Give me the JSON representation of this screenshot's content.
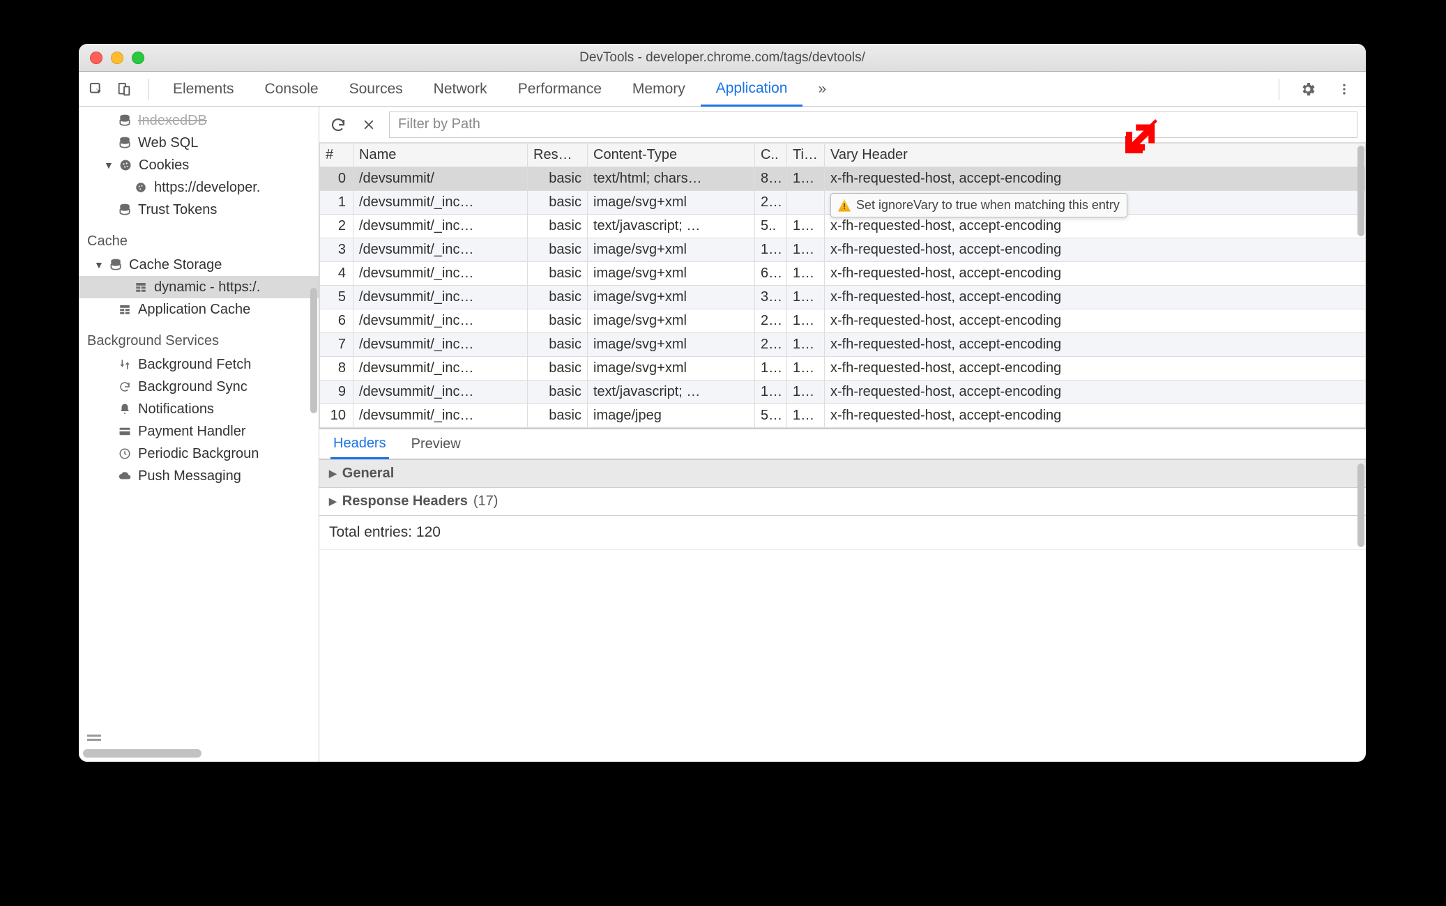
{
  "window": {
    "title": "DevTools - developer.chrome.com/tags/devtools/"
  },
  "tabs": {
    "items": [
      "Elements",
      "Console",
      "Sources",
      "Network",
      "Performance",
      "Memory",
      "Application"
    ],
    "active": "Application",
    "overflow": "»"
  },
  "sidebar": {
    "storage": {
      "indexeddb": "IndexedDB",
      "websql": "Web SQL",
      "cookies": "Cookies",
      "cookie_origin": "https://developer.",
      "trust_tokens": "Trust Tokens"
    },
    "cache": {
      "label": "Cache",
      "cache_storage": "Cache Storage",
      "cache_item": "dynamic - https:/.",
      "app_cache": "Application Cache"
    },
    "bg": {
      "label": "Background Services",
      "fetch": "Background Fetch",
      "sync": "Background Sync",
      "notifications": "Notifications",
      "payment": "Payment Handler",
      "periodic": "Periodic Backgroun",
      "push": "Push Messaging"
    }
  },
  "toolbar": {
    "filter_placeholder": "Filter by Path"
  },
  "table": {
    "headers": {
      "num": "#",
      "name": "Name",
      "res": "Res…",
      "ct": "Content-Type",
      "c": "C..",
      "t": "Ti…",
      "vary": "Vary Header"
    },
    "rows": [
      {
        "n": "0",
        "name": "/devsummit/",
        "res": "basic",
        "ct": "text/html; chars…",
        "c": "8…",
        "t": "1…",
        "vary": "x-fh-requested-host, accept-encoding"
      },
      {
        "n": "1",
        "name": "/devsummit/_inc…",
        "res": "basic",
        "ct": "image/svg+xml",
        "c": "2…",
        "t": "",
        "vary": ""
      },
      {
        "n": "2",
        "name": "/devsummit/_inc…",
        "res": "basic",
        "ct": "text/javascript; …",
        "c": "5..",
        "t": "1…",
        "vary": "x-fh-requested-host, accept-encoding"
      },
      {
        "n": "3",
        "name": "/devsummit/_inc…",
        "res": "basic",
        "ct": "image/svg+xml",
        "c": "1…",
        "t": "1…",
        "vary": "x-fh-requested-host, accept-encoding"
      },
      {
        "n": "4",
        "name": "/devsummit/_inc…",
        "res": "basic",
        "ct": "image/svg+xml",
        "c": "6…",
        "t": "1…",
        "vary": "x-fh-requested-host, accept-encoding"
      },
      {
        "n": "5",
        "name": "/devsummit/_inc…",
        "res": "basic",
        "ct": "image/svg+xml",
        "c": "3…",
        "t": "1…",
        "vary": "x-fh-requested-host, accept-encoding"
      },
      {
        "n": "6",
        "name": "/devsummit/_inc…",
        "res": "basic",
        "ct": "image/svg+xml",
        "c": "2…",
        "t": "1…",
        "vary": "x-fh-requested-host, accept-encoding"
      },
      {
        "n": "7",
        "name": "/devsummit/_inc…",
        "res": "basic",
        "ct": "image/svg+xml",
        "c": "2…",
        "t": "1…",
        "vary": "x-fh-requested-host, accept-encoding"
      },
      {
        "n": "8",
        "name": "/devsummit/_inc…",
        "res": "basic",
        "ct": "image/svg+xml",
        "c": "1…",
        "t": "1…",
        "vary": "x-fh-requested-host, accept-encoding"
      },
      {
        "n": "9",
        "name": "/devsummit/_inc…",
        "res": "basic",
        "ct": "text/javascript; …",
        "c": "1…",
        "t": "1…",
        "vary": "x-fh-requested-host, accept-encoding"
      },
      {
        "n": "10",
        "name": "/devsummit/_inc…",
        "res": "basic",
        "ct": "image/jpeg",
        "c": "5…",
        "t": "1…",
        "vary": "x-fh-requested-host, accept-encoding"
      }
    ]
  },
  "tooltip": {
    "text": "Set ignoreVary to true when matching this entry"
  },
  "details": {
    "tabs": [
      "Headers",
      "Preview"
    ],
    "active": "Headers",
    "general": "General",
    "response_headers": "Response Headers",
    "response_count": "(17)",
    "total": "Total entries: 120"
  }
}
